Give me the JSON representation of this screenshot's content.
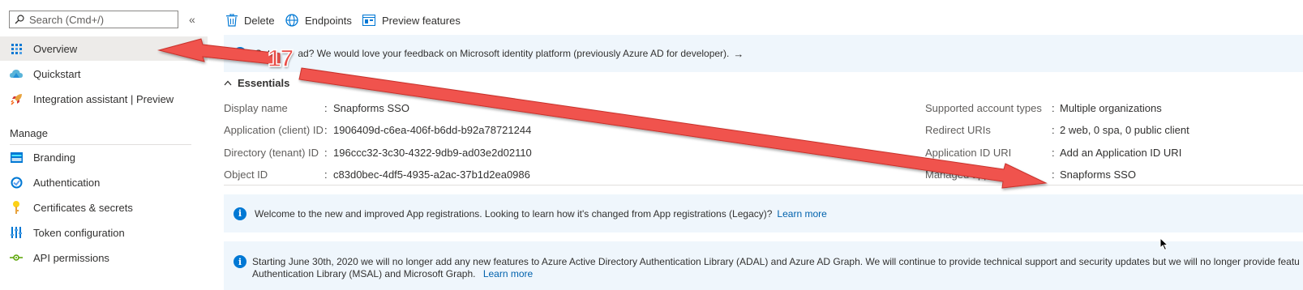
{
  "sidebar": {
    "search_placeholder": "Search (Cmd+/)",
    "collapse_glyph": "«",
    "items": [
      {
        "label": "Overview",
        "icon": "overview-grid-icon"
      },
      {
        "label": "Quickstart",
        "icon": "cloud-icon"
      },
      {
        "label": "Integration assistant | Preview",
        "icon": "rocket-icon"
      }
    ],
    "section_manage": "Manage",
    "manage_items": [
      {
        "label": "Branding",
        "icon": "branding-icon"
      },
      {
        "label": "Authentication",
        "icon": "authentication-icon"
      },
      {
        "label": "Certificates & secrets",
        "icon": "key-icon"
      },
      {
        "label": "Token configuration",
        "icon": "token-bars-icon"
      },
      {
        "label": "API permissions",
        "icon": "api-permissions-icon"
      }
    ]
  },
  "toolbar": {
    "delete_label": "Delete",
    "endpoints_label": "Endpoints",
    "preview_label": "Preview features"
  },
  "feedback_banner": {
    "text_part1": "Got",
    "text_part2": "ad? We would love your feedback on Microsoft identity platform (previously Azure AD for developer).",
    "arrow": "→"
  },
  "essentials": {
    "title": "Essentials",
    "left": [
      {
        "label": "Display name",
        "value": "Snapforms SSO",
        "link": true
      },
      {
        "label": "Application (client) ID",
        "value": "1906409d-c6ea-406f-b6dd-b92a78721244",
        "link": false
      },
      {
        "label": "Directory (tenant) ID",
        "value": "196ccc32-3c30-4322-9db9-ad03e2d02110",
        "link": false
      },
      {
        "label": "Object ID",
        "value": "c83d0bec-4df5-4935-a2ac-37b1d2ea0986",
        "link": false
      }
    ],
    "right": [
      {
        "label": "Supported account types",
        "value": "Multiple organizations"
      },
      {
        "label": "Redirect URIs",
        "value": "2 web, 0 spa, 0 public client"
      },
      {
        "label": "Application ID URI",
        "value": "Add an Application ID URI"
      },
      {
        "label": "Managed application ...",
        "value": "Snapforms SSO"
      }
    ]
  },
  "welcome_banner": {
    "text": "Welcome to the new and improved App registrations. Looking to learn how it's changed from App registrations (Legacy)?",
    "link": "Learn more"
  },
  "adal_banner": {
    "line1": "Starting June 30th, 2020 we will no longer add any new features to Azure Active Directory Authentication Library (ADAL) and Azure AD Graph. We will continue to provide technical support and security updates but we will no longer provide featu",
    "line2": "Authentication Library (MSAL) and Microsoft Graph.",
    "link": "Learn more"
  },
  "annotation": {
    "number": "17",
    "arrow_color": "#f0524d"
  }
}
